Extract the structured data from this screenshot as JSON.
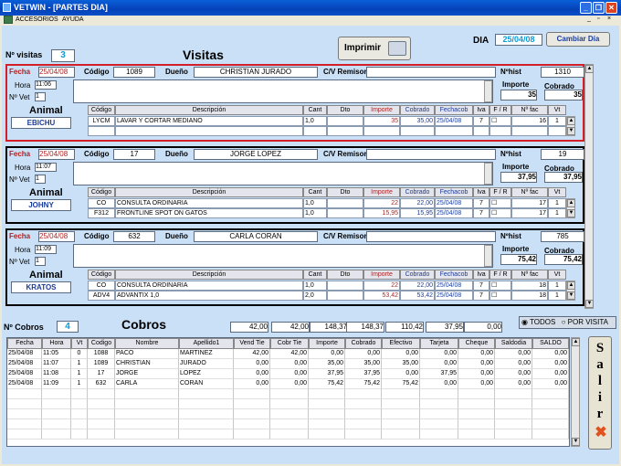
{
  "window": {
    "title": "VETWIN - [PARTES DIA]"
  },
  "menu": {
    "items": [
      "ACCESORIOS",
      "AYUDA"
    ]
  },
  "header": {
    "visits_label": "Nº visitas",
    "visits_count": "3",
    "visits_title": "Visitas",
    "print_label": "Imprimir",
    "dia_label": "DIA",
    "dia_value": "25/04/08",
    "change_day_label": "Cambiar Día"
  },
  "labels": {
    "fecha": "Fecha",
    "codigo": "Código",
    "dueno": "Dueño",
    "cv": "C/V Remisor",
    "nhist": "Nºhist",
    "hora": "Hora",
    "nvet": "Nº Vet",
    "importe": "Importe",
    "cobrado": "Cobrado",
    "animal": "Animal"
  },
  "columns": [
    "Código",
    "Descripción",
    "Cant",
    "Dto",
    "Importe",
    "Cobrado",
    "Fechacob",
    "Iva",
    "F / R",
    "Nº fac",
    "Vt"
  ],
  "visits": [
    {
      "fecha": "25/04/08",
      "hora": "11:06",
      "nvet": "1",
      "codigo": "1089",
      "dueno": "CHRISTIAN JURADO",
      "cv": "",
      "nhist": "1310",
      "importe": "35",
      "cobrado": "35",
      "animal": "EBICHU",
      "rows": [
        {
          "cod": "LYCM",
          "desc": "LAVAR Y CORTAR MEDIANO",
          "cant": "1,0",
          "dto": "",
          "imp": "35",
          "cob": "35,00",
          "fcob": "25/04/08",
          "iva": "7",
          "fr": "",
          "nfac": "16",
          "vt": "1"
        }
      ]
    },
    {
      "fecha": "25/04/08",
      "hora": "11:07",
      "nvet": "1",
      "codigo": "17",
      "dueno": "JORGE LOPEZ",
      "cv": "",
      "nhist": "19",
      "importe": "37,95",
      "cobrado": "37,95",
      "animal": "JOHNY",
      "rows": [
        {
          "cod": "CO",
          "desc": "CONSULTA  ORDINARIA",
          "cant": "1,0",
          "dto": "",
          "imp": "22",
          "cob": "22,00",
          "fcob": "25/04/08",
          "iva": "7",
          "fr": "",
          "nfac": "17",
          "vt": "1"
        },
        {
          "cod": "F312",
          "desc": "FRONTLINE SPOT ON GATOS",
          "cant": "1,0",
          "dto": "",
          "imp": "15,95",
          "cob": "15,95",
          "fcob": "25/04/08",
          "iva": "7",
          "fr": "",
          "nfac": "17",
          "vt": "1"
        }
      ]
    },
    {
      "fecha": "25/04/08",
      "hora": "11:09",
      "nvet": "1",
      "codigo": "632",
      "dueno": "CARLA CORAN",
      "cv": "",
      "nhist": "785",
      "importe": "75,42",
      "cobrado": "75,42",
      "animal": "KRATOS",
      "rows": [
        {
          "cod": "CO",
          "desc": "CONSULTA  ORDINARIA",
          "cant": "1,0",
          "dto": "",
          "imp": "22",
          "cob": "22,00",
          "fcob": "25/04/08",
          "iva": "7",
          "fr": "",
          "nfac": "18",
          "vt": "1"
        },
        {
          "cod": "ADV4",
          "desc": "ADVANTIX 1,0",
          "cant": "2,0",
          "dto": "",
          "imp": "53,42",
          "cob": "53,42",
          "fcob": "25/04/08",
          "iva": "7",
          "fr": "",
          "nfac": "18",
          "vt": "1"
        }
      ]
    }
  ],
  "cobros": {
    "count_label": "Nº Cobros",
    "count": "4",
    "title": "Cobros",
    "totals": [
      "42,00",
      "42,00",
      "148,37",
      "148,37",
      "110,42",
      "37,95",
      "0,00"
    ],
    "filter_all": "TODOS",
    "filter_visit": "POR VISITA",
    "columns": [
      "Fecha",
      "Hora",
      "Vt",
      "Codigo",
      "Nombre",
      "Apellido1",
      "Vend Tie",
      "Cobr Tie",
      "Importe",
      "Cobrado",
      "Efectivo",
      "Tarjeta",
      "Cheque",
      "Saldodia",
      "SALDO"
    ],
    "rows": [
      [
        "25/04/08",
        "11:05",
        "0",
        "1088",
        "PACO",
        "MARTINEZ",
        "42,00",
        "42,00",
        "0,00",
        "0,00",
        "0,00",
        "0,00",
        "0,00",
        "0,00",
        "0,00"
      ],
      [
        "25/04/08",
        "11:07",
        "1",
        "1089",
        "CHRISTIAN",
        "JURADO",
        "0,00",
        "0,00",
        "35,00",
        "35,00",
        "35,00",
        "0,00",
        "0,00",
        "0,00",
        "0,00"
      ],
      [
        "25/04/08",
        "11:08",
        "1",
        "17",
        "JORGE",
        "LOPEZ",
        "0,00",
        "0,00",
        "37,95",
        "37,95",
        "0,00",
        "37,95",
        "0,00",
        "0,00",
        "0,00"
      ],
      [
        "25/04/08",
        "11:09",
        "1",
        "632",
        "CARLA",
        "CORAN",
        "0,00",
        "0,00",
        "75,42",
        "75,42",
        "75,42",
        "0,00",
        "0,00",
        "0,00",
        "0,00"
      ]
    ]
  },
  "exit_letters": [
    "S",
    "a",
    "l",
    "i",
    "r"
  ]
}
